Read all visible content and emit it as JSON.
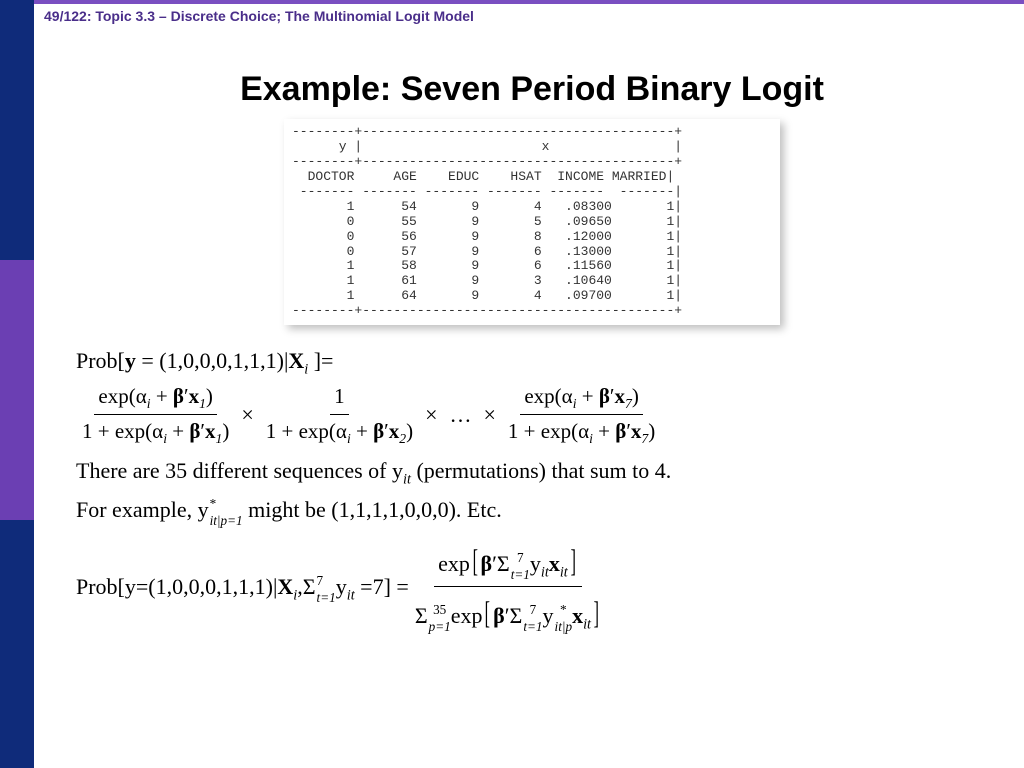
{
  "header": {
    "text": "49/122: Topic 3.3 – Discrete Choice; The Multinomial Logit Model"
  },
  "title": "Example: Seven Period Binary Logit",
  "table": {
    "header_y": "y",
    "header_x": "x",
    "cols": [
      "DOCTOR",
      "AGE",
      "EDUC",
      "HSAT",
      "INCOME",
      "MARRIED"
    ],
    "rows": [
      {
        "DOCTOR": "1",
        "AGE": "54",
        "EDUC": "9",
        "HSAT": "4",
        "INCOME": ".08300",
        "MARRIED": "1"
      },
      {
        "DOCTOR": "0",
        "AGE": "55",
        "EDUC": "9",
        "HSAT": "5",
        "INCOME": ".09650",
        "MARRIED": "1"
      },
      {
        "DOCTOR": "0",
        "AGE": "56",
        "EDUC": "9",
        "HSAT": "8",
        "INCOME": ".12000",
        "MARRIED": "1"
      },
      {
        "DOCTOR": "0",
        "AGE": "57",
        "EDUC": "9",
        "HSAT": "6",
        "INCOME": ".13000",
        "MARRIED": "1"
      },
      {
        "DOCTOR": "1",
        "AGE": "58",
        "EDUC": "9",
        "HSAT": "6",
        "INCOME": ".11560",
        "MARRIED": "1"
      },
      {
        "DOCTOR": "1",
        "AGE": "61",
        "EDUC": "9",
        "HSAT": "3",
        "INCOME": ".10640",
        "MARRIED": "1"
      },
      {
        "DOCTOR": "1",
        "AGE": "64",
        "EDUC": "9",
        "HSAT": "4",
        "INCOME": ".09700",
        "MARRIED": "1"
      }
    ]
  },
  "math": {
    "prob_expr_lhs": "Prob[",
    "y_vec": "y",
    "y_val": " = (1,0,0,0,1,1,1)|",
    "X": "X",
    "sub_i": "i",
    "rhs_eq": " ]=",
    "exp": "exp(",
    "alpha": "α",
    "plus": " + ",
    "beta": "β",
    "prime": "′",
    "x": "x",
    "close": ")",
    "one_plus": "1 + exp(",
    "one": "1",
    "mult": "×",
    "dots": "…",
    "sub_1": "1",
    "sub_2": "2",
    "sub_7": "7",
    "text1a": "There are 35 different sequences of y",
    "text1_sub": "it",
    "text1b": "  (permutations) that sum to 4.",
    "text2a": "For example, y",
    "text2_supstar": "*",
    "text2_sub": "it|p=1",
    "text2b": " might be (1,1,1,1,0,0,0). Etc.",
    "prob2_lhs": "Prob[y=(1,0,0,0,1,1,1)|",
    "comma": ",",
    "Sigma": "Σ",
    "tsum_top": "7",
    "tsum_bot": "t=1",
    "y_it": "y",
    "eq7": " =7] = ",
    "psum_top": "35",
    "psum_bot": "p=1",
    "ystar_sub": "it|p"
  }
}
